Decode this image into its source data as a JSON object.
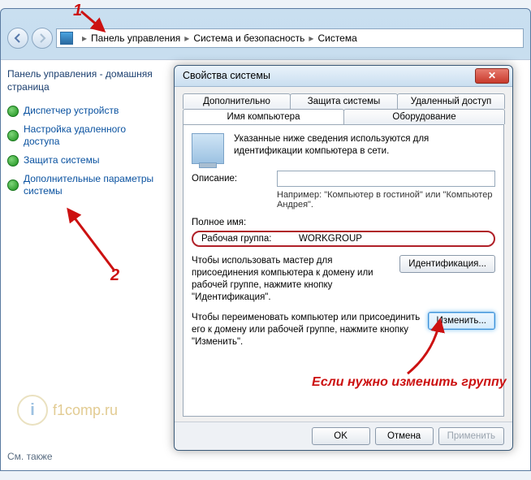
{
  "breadcrumb": {
    "seg1": "Панель управления",
    "seg2": "Система и безопасность",
    "seg3": "Система"
  },
  "sidebar": {
    "title": "Панель управления - домашняя страница",
    "items": [
      "Диспетчер устройств",
      "Настройка удаленного доступа",
      "Защита системы",
      "Дополнительные параметры системы"
    ],
    "see_also": "См. также"
  },
  "watermark": "f1comp.ru",
  "dialog": {
    "title": "Свойства системы",
    "tabs_row1": [
      "Дополнительно",
      "Защита системы",
      "Удаленный доступ"
    ],
    "tabs_row2": [
      "Имя компьютера",
      "Оборудование"
    ],
    "info": "Указанные ниже сведения используются для идентификации компьютера в сети.",
    "desc_label": "Описание:",
    "desc_value": "",
    "desc_hint": "Например: \"Компьютер в гостиной\" или \"Компьютер Андрея\".",
    "fullname_label": "Полное имя:",
    "workgroup_label": "Рабочая группа:",
    "workgroup_value": "WORKGROUP",
    "ident_text": "Чтобы использовать мастер для присоединения компьютера к домену или рабочей группе, нажмите кнопку \"Идентификация\".",
    "ident_btn": "Идентификация...",
    "change_text": "Чтобы переименовать компьютер или присоединить его к домену или рабочей группе, нажмите кнопку \"Изменить\".",
    "change_btn": "Изменить...",
    "ok": "OK",
    "cancel": "Отмена",
    "apply": "Применить"
  },
  "annotations": {
    "n1": "1",
    "n2": "2",
    "caption": "Если нужно изменить группу"
  }
}
